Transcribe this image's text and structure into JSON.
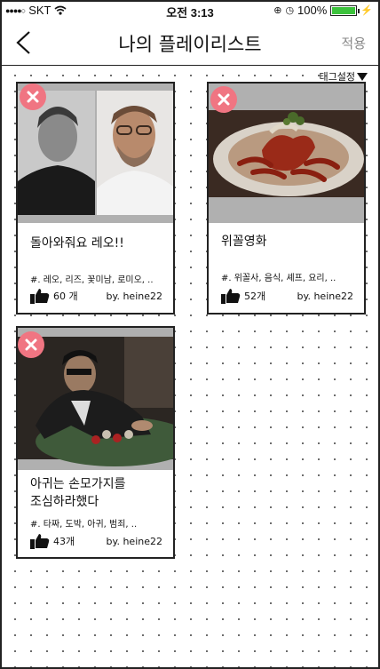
{
  "status": {
    "carrier": "SKT",
    "time": "오전 3:13",
    "battery": "100%"
  },
  "header": {
    "title": "나의 플레이리스트",
    "apply_label": "적용"
  },
  "tag_settings_label": "태그설정",
  "colors": {
    "close": "#f07582",
    "battery": "#3cc23c",
    "apply": "#888888"
  },
  "cards": [
    {
      "title": "돌아와줘요 레오!!",
      "tags": "#. 레오, 리즈, 꽃미남, 로미오, ..",
      "likes": "60 개",
      "author": "by. heine22"
    },
    {
      "title": "위꼴영화",
      "tags": "#. 위꼴사, 음식, 셰프, 요리, ..",
      "likes": "52개",
      "author": "by. heine22"
    },
    {
      "title_line1": "아귀는 손모가지를",
      "title_line2": "조심하라했다",
      "tags": "#. 타짜, 도박, 아귀, 범죄, ..",
      "likes": "43개",
      "author": "by. heine22"
    }
  ]
}
